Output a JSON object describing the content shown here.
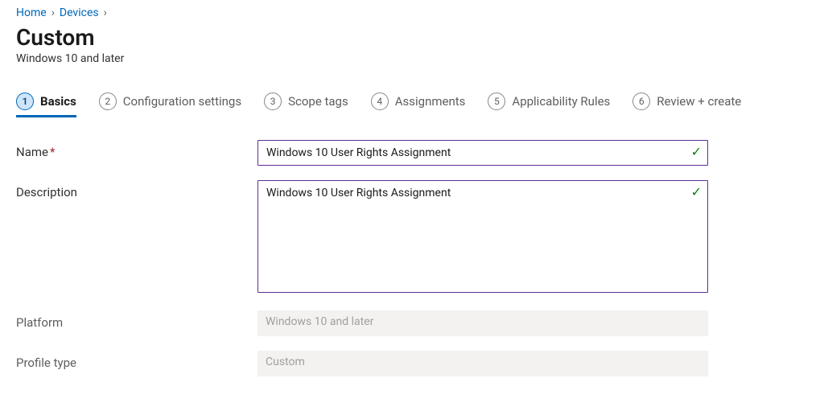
{
  "breadcrumb": {
    "home": "Home",
    "devices": "Devices"
  },
  "header": {
    "title": "Custom",
    "subtitle": "Windows 10 and later"
  },
  "steps": [
    {
      "num": "1",
      "label": "Basics"
    },
    {
      "num": "2",
      "label": "Configuration settings"
    },
    {
      "num": "3",
      "label": "Scope tags"
    },
    {
      "num": "4",
      "label": "Assignments"
    },
    {
      "num": "5",
      "label": "Applicability Rules"
    },
    {
      "num": "6",
      "label": "Review + create"
    }
  ],
  "form": {
    "name_label": "Name",
    "name_value": "Windows 10 User Rights Assignment",
    "description_label": "Description",
    "description_value": "Windows 10 User Rights Assignment",
    "platform_label": "Platform",
    "platform_value": "Windows 10 and later",
    "profile_type_label": "Profile type",
    "profile_type_value": "Custom"
  }
}
